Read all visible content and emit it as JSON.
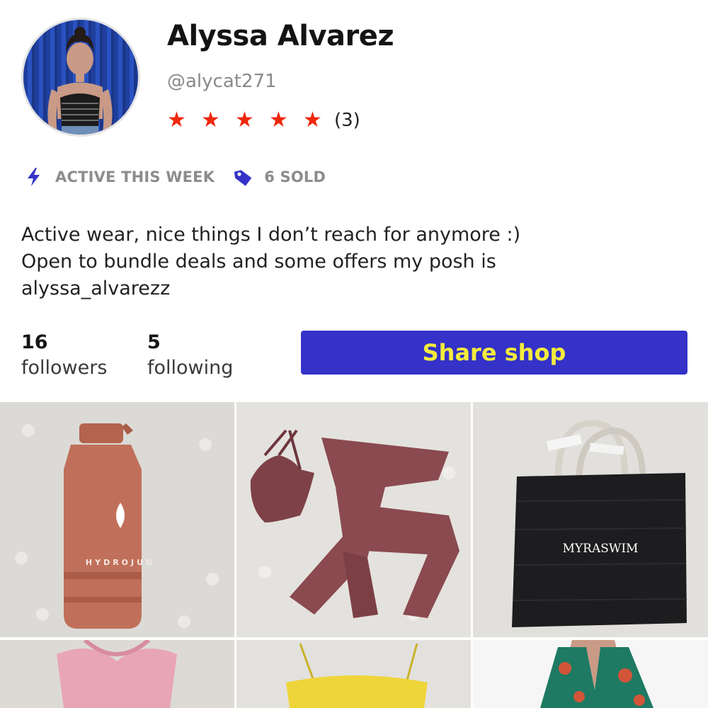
{
  "profile": {
    "name": "Alyssa Alvarez",
    "handle": "@alycat271",
    "rating": {
      "stars": 5,
      "count": "(3)"
    },
    "badges": [
      {
        "icon": "lightning-bolt-icon",
        "label": "ACTIVE THIS WEEK"
      },
      {
        "icon": "price-tag-icon",
        "label": "6 SOLD"
      }
    ],
    "bio_lines": [
      "Active wear, nice things I don’t reach for anymore :)",
      "Open to bundle deals and some offers my posh is",
      "alyssa_alvarezz"
    ]
  },
  "stats": {
    "followers": {
      "count": "16",
      "label": "followers"
    },
    "following": {
      "count": "5",
      "label": "following"
    }
  },
  "share_button": {
    "label": "Share shop"
  },
  "listings": [
    {
      "item": "water jug",
      "print": "HYDROJUG"
    },
    {
      "item": "sports bra and leggings"
    },
    {
      "item": "tote bag",
      "print": "MYRASWIM"
    },
    {
      "item": "pink top"
    },
    {
      "item": "yellow top"
    },
    {
      "item": "floral dress"
    }
  ],
  "colors": {
    "accent": "#3432c8",
    "button_text": "#f4ec3c",
    "star": "#f0280f",
    "badge_icon": "#3432c8"
  }
}
